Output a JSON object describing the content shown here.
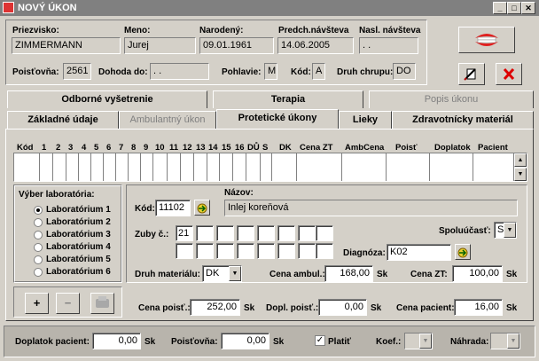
{
  "window": {
    "title": "NOVÝ ÚKON"
  },
  "patient": {
    "labels": {
      "surname": "Priezvisko:",
      "name": "Meno:",
      "birth": "Narodený:",
      "prev_visit": "Predch.návšteva",
      "next_visit": "Nasl. návšteva",
      "insurance": "Poisťovňa:",
      "contract": "Dohoda do:",
      "gender": "Pohlavie:",
      "code": "Kód:",
      "group": "Druh chrupu:"
    },
    "surname": "ZIMMERMANN",
    "name": "Jurej",
    "birth": "09.01.1961",
    "prev_visit": "14.06.2005",
    "next_visit": ". .",
    "insurance": "2561",
    "contract": ". .",
    "gender": "M",
    "code": "A",
    "group": "DO"
  },
  "tabs_top": [
    "Odborné vyšetrenie",
    "Terapia",
    "Popis úkonu"
  ],
  "tabs_bottom": [
    "Základné údaje",
    "Ambulantný úkon",
    "Protetické úkony",
    "Lieky",
    "Zdravotnícky materiál"
  ],
  "grid_headers": [
    "Kód",
    "1",
    "2",
    "3",
    "4",
    "5",
    "6",
    "7",
    "8",
    "9",
    "10",
    "11",
    "12",
    "13",
    "14",
    "15",
    "16",
    "DŮ",
    "S",
    "DK",
    "Cena ZT",
    "AmbCena",
    "Poisť",
    "Doplatok",
    "Pacient"
  ],
  "lab": {
    "title": "Výber laboratória:",
    "items": [
      "Laboratórium 1",
      "Laboratórium 2",
      "Laboratórium 3",
      "Laboratórium 4",
      "Laboratórium 5",
      "Laboratórium 6"
    ],
    "selected": 0
  },
  "lab_buttons": {
    "add": "+",
    "remove": "−"
  },
  "detail": {
    "code_label": "Kód:",
    "code": "11102",
    "name_label": "Názov:",
    "name": "Inlej koreňová",
    "teeth_label": "Zuby č.:",
    "tooth_first": "21",
    "copay_label": "Spoluúčasť:",
    "copay": "S",
    "diagnosis_label": "Diagnóza:",
    "diagnosis": "K02",
    "material_label": "Druh materiálu:",
    "material": "DK",
    "amb_price_label": "Cena ambul.:",
    "amb_price": "168,00",
    "zt_price_label": "Cena ZT:",
    "zt_price": "100,00",
    "ins_price_label": "Cena poisť.:",
    "ins_price": "252,00",
    "ins_extra_label": "Dopl. poisť.:",
    "ins_extra": "0,00",
    "patient_price_label": "Cena pacient:",
    "patient_price": "16,00",
    "currency": "Sk"
  },
  "footer": {
    "patient_pay_label": "Doplatok pacient:",
    "patient_pay": "0,00",
    "insurance_label": "Poisťovňa:",
    "insurance": "0,00",
    "paid_label": "Platiť",
    "coef_label": "Koef.:",
    "replace_label": "Náhrada:",
    "currency": "Sk"
  }
}
